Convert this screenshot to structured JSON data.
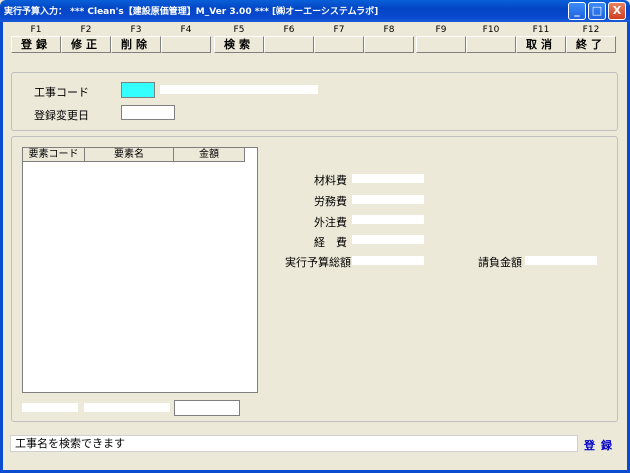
{
  "window": {
    "title": "実行予算入力： *** Clean's【建設原価管理】M_Ver 3.00 *** [㈱オーエーシステムラボ]",
    "minimize": "_",
    "maximize": "□",
    "close": "X"
  },
  "fkeys": [
    {
      "key": "F1",
      "label": "登録"
    },
    {
      "key": "F2",
      "label": "修正"
    },
    {
      "key": "F3",
      "label": "削除"
    },
    {
      "key": "F4",
      "label": ""
    },
    {
      "key": "F5",
      "label": "検索"
    },
    {
      "key": "F6",
      "label": ""
    },
    {
      "key": "F7",
      "label": ""
    },
    {
      "key": "F8",
      "label": ""
    },
    {
      "key": "F9",
      "label": ""
    },
    {
      "key": "F10",
      "label": ""
    },
    {
      "key": "F11",
      "label": "取消"
    },
    {
      "key": "F12",
      "label": "終了"
    }
  ],
  "header": {
    "project_code_label": "工事コード",
    "registered_date_label": "登録変更日"
  },
  "grid": {
    "columns": [
      "要素コード",
      "要素名",
      "金額"
    ]
  },
  "costs": {
    "material_label": "材料費",
    "labor_label": "労務費",
    "outsource_label": "外注費",
    "expense_label": "経　費",
    "total_label": "実行予算総額",
    "contract_label": "請負金額"
  },
  "status": {
    "message": "工事名を検索できます",
    "link": "登録"
  },
  "colors": {
    "active_input": "#33ffff",
    "titlebar": "#0a4bd0"
  }
}
